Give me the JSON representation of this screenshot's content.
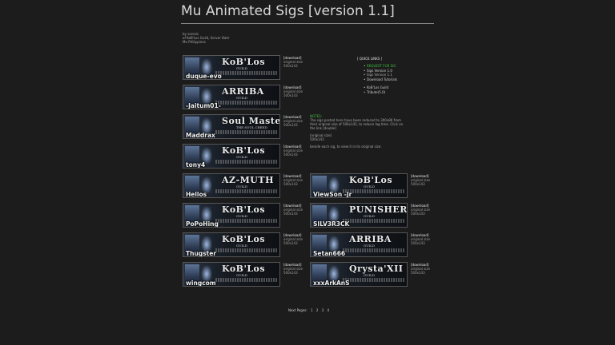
{
  "title": "Mu Animated Sigs [version 1.1]",
  "credits": [
    "by saresis",
    "of KoB'Los Guild, Server Bahr",
    "Mu Philippines"
  ],
  "download_label": "[download]",
  "orig_label": "original size",
  "orig_size": "500x143",
  "sigs_left": [
    {
      "name": "duque-evo",
      "logo": "KoB'Los",
      "sub": "GUILD"
    },
    {
      "name": "-Jaitum01-",
      "logo": "ARRIBA",
      "sub": "GUILD"
    },
    {
      "name": "Maddrax",
      "logo": "Soul Master",
      "sub": "THE SOUL CREED"
    },
    {
      "name": "tony4",
      "logo": "KoB'Los",
      "sub": "GUILD"
    },
    {
      "name": "Hellos",
      "logo": "AZ-MUTH",
      "sub": "GUILD"
    },
    {
      "name": "PoPoHing",
      "logo": "KoB'Los",
      "sub": "GUILD"
    },
    {
      "name": "Thugster",
      "logo": "KoB'Los",
      "sub": "GUILD"
    },
    {
      "name": "wingcom",
      "logo": "KoB'Los",
      "sub": "GUILD"
    }
  ],
  "sigs_right": [
    {
      "name": "ViewSon -Jr",
      "logo": "KoB'Los",
      "sub": "GUILD"
    },
    {
      "name": "SILV3R3CK",
      "logo": "PUNISHER",
      "sub": "GUILD"
    },
    {
      "name": "Setan666",
      "logo": "ARRIBA",
      "sub": "GUILD"
    },
    {
      "name": "xxxArkAnS",
      "logo": "Qrysta'XII",
      "sub": "GUILD"
    }
  ],
  "quick_links": {
    "heading": "[ QUICK LINKS ]",
    "items": [
      {
        "label": "REQUEST FOR SIG",
        "cls": "req"
      },
      {
        "label": "Sigs Version 1.0",
        "cls": ""
      },
      {
        "label": "Sigs Version 1.1",
        "cls": "sub2"
      },
      {
        "label": "Download Tutorials",
        "cls": ""
      },
      {
        "label": "KoB'Los Guild",
        "cls": "gap"
      },
      {
        "label": "Tribute(5.0)",
        "cls": ""
      }
    ]
  },
  "notes": {
    "heading": "NOTES:",
    "body": "The sigs posted here have been reduced to 300x86 from their original size of 500x143, to reduce lag time. Click on the link [double]",
    "orig_heading": "[original size]",
    "orig_value": "500x143",
    "tail": "beside each sig, to view it in its original size."
  },
  "pager": {
    "label": "Next Pages:",
    "pages": [
      "1",
      "2",
      "3",
      "4"
    ]
  },
  "colors": {
    "background": "#1c1c1c",
    "accent_green": "#3fbf3f"
  }
}
